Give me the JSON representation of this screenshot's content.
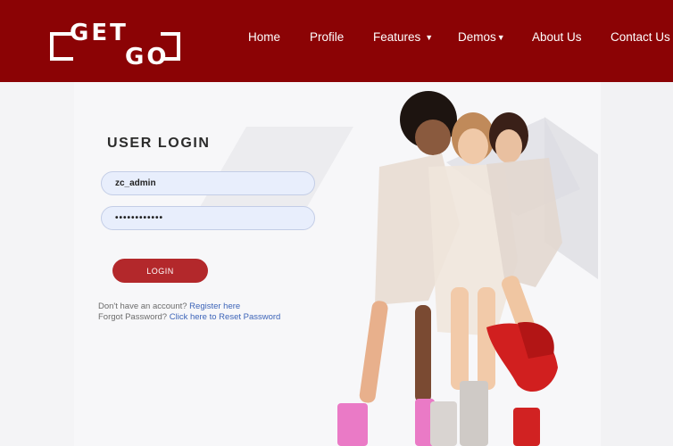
{
  "header": {
    "logo_top": "GET",
    "logo_bottom": "GO",
    "nav": [
      {
        "label": "Home"
      },
      {
        "label": "Profile"
      },
      {
        "label": "Features"
      },
      {
        "label": "Demos"
      },
      {
        "label": "About Us"
      },
      {
        "label": "Contact Us"
      }
    ]
  },
  "login": {
    "title": "USER LOGIN",
    "username_value": "zc_admin",
    "password_value": "••••••••••••",
    "button_label": "LOGIN",
    "register_prefix": "Don't have an account?",
    "register_link": "Register here",
    "forgot_prefix": "Forgot Password?",
    "forgot_link": "Click here to Reset Password"
  },
  "colors": {
    "header_bg": "#8b0305",
    "button_bg": "#b3282b",
    "link": "#3d64b8"
  }
}
